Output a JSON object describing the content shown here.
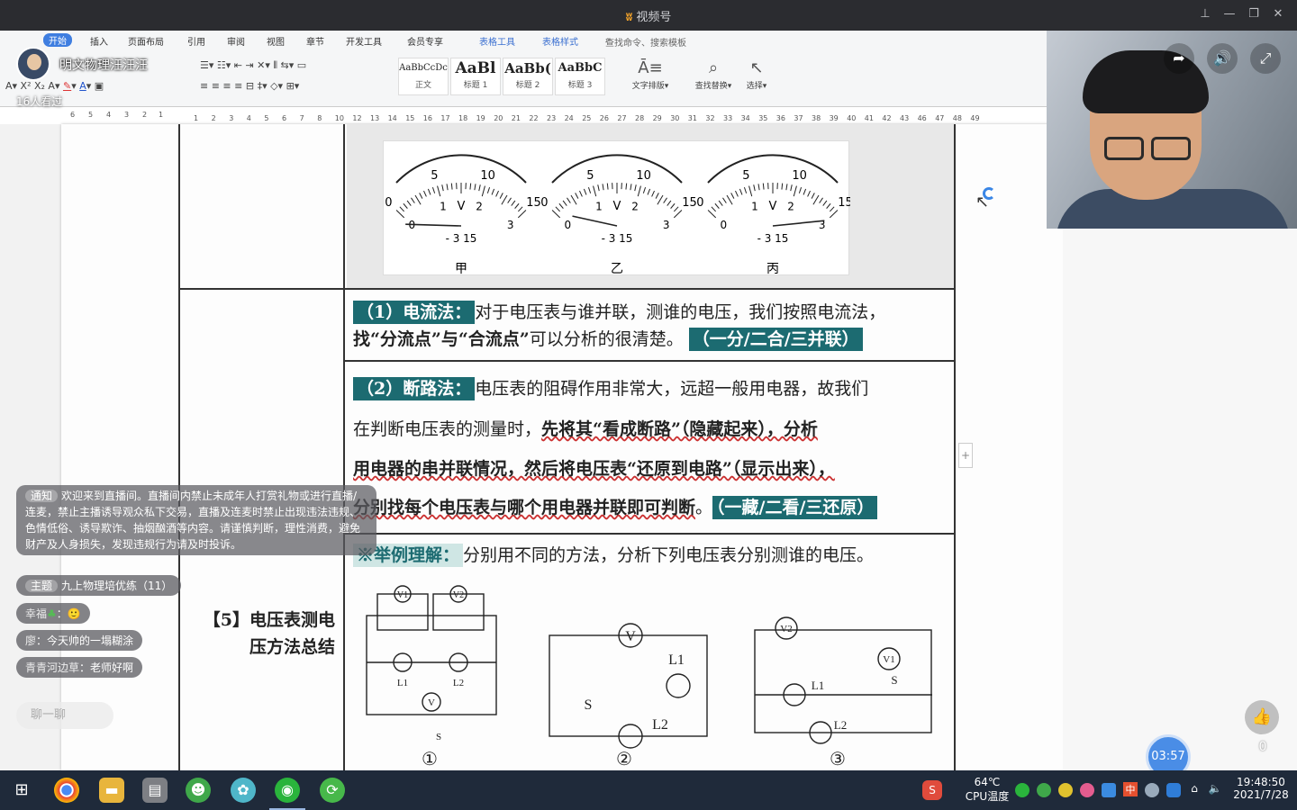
{
  "window": {
    "title": "视频号",
    "buttons": [
      "pin",
      "minimize",
      "restore",
      "close"
    ]
  },
  "host": {
    "name": "明文物理汪汪汪",
    "viewers": "16人看过"
  },
  "ribbon": {
    "menu": [
      "开始",
      "插入",
      "页面布局",
      "引用",
      "审阅",
      "视图",
      "章节",
      "开发工具",
      "会员专享",
      "表格工具",
      "表格样式"
    ],
    "search": "查找命令、搜索模板",
    "styles": [
      {
        "preview": "AaBbCcDc",
        "name": "正文"
      },
      {
        "preview": "AaBl",
        "name": "标题 1"
      },
      {
        "preview": "AaBb(",
        "name": "标题 2"
      },
      {
        "preview": "AaBbC",
        "name": "标题 3"
      }
    ],
    "tools": [
      {
        "icon": "text-layout-icon",
        "label": "文字排版"
      },
      {
        "icon": "find-replace-icon",
        "label": "查找替换"
      },
      {
        "icon": "select-icon",
        "label": "选择"
      }
    ]
  },
  "ruler": {
    "left": [
      "6",
      "5",
      "4",
      "3",
      "2",
      "1"
    ],
    "right": [
      "1",
      "2",
      "3",
      "4",
      "5",
      "6",
      "7",
      "8",
      "10",
      "12",
      "13",
      "14",
      "15",
      "16",
      "17",
      "18",
      "19",
      "20",
      "21",
      "22",
      "23",
      "24",
      "25",
      "26",
      "27",
      "28",
      "29",
      "30",
      "31",
      "32",
      "33",
      "34",
      "35",
      "36",
      "37",
      "38",
      "39",
      "40",
      "41",
      "42",
      "43",
      "46",
      "47",
      "48",
      "49"
    ]
  },
  "doc": {
    "meters": {
      "labels": [
        "甲",
        "乙",
        "丙"
      ],
      "scale_top": [
        "0",
        "5",
        "10",
        "15"
      ],
      "scale_bottom": [
        "0",
        "1",
        "2",
        "3"
      ],
      "unit": "V",
      "terminals": "- 3 15"
    },
    "method1": {
      "label": "（1）电流法：",
      "line1": "对于电压表与谁并联，测谁的电压，我们按照电流法，",
      "line2a": "找“分流点”与“合流点”",
      "line2b": "可以分析的很清楚。",
      "tag": "（一分/二合/三并联）"
    },
    "method2": {
      "label": "（2）断路法：",
      "line1": "电压表的阻碍作用非常大，远超一般用电器，故我们",
      "line2a": "在判断电压表的测量时，",
      "line2b": "先将其“看成断路”（隐藏起来），分析",
      "line3": "用电器的串并联情况，然后将电压表“还原到电路”（显示出来），",
      "line4a": "分别找每个电压表与哪个用电器并联即可判断",
      "line4b": "。",
      "tag": "（一藏/二看/三还原）"
    },
    "example": {
      "label": "※举例理解：",
      "text": "分别用不同的方法，分析下列电压表分别测谁的电压。"
    },
    "section_title_1": "【5】电压表测电",
    "section_title_2": "压方法总结",
    "circuits": {
      "numbers": [
        "①",
        "②",
        "③"
      ],
      "labels": [
        "V1",
        "V2",
        "V",
        "L1",
        "L2",
        "S"
      ]
    }
  },
  "chat": {
    "notice_tag": "通知",
    "notice": "欢迎来到直播间。直播间内禁止未成年人打赏礼物或进行直播/连麦，禁止主播诱导观众私下交易，直播及连麦时禁止出现违法违规、色情低俗、诱导欺诈、抽烟酗酒等内容。请谨慎判断，理性消费，避免财产及人身损失，发现违规行为请及时投诉。",
    "topic_tag": "主题",
    "topic": "九上物理培优练（11）",
    "messages": [
      {
        "user": "幸福",
        "text": "🙂"
      },
      {
        "user": "廖",
        "text": "今天帅的一塌糊涂"
      },
      {
        "user": "青青河边草",
        "text": "老师好啊"
      }
    ],
    "input_placeholder": "聊一聊"
  },
  "live": {
    "likes": "0",
    "timer": "03:57"
  },
  "taskbar": {
    "apps": [
      "start-icon",
      "chrome-icon",
      "folder-icon",
      "files-icon",
      "frog-icon",
      "gear-flower-icon",
      "wechat-icon",
      "green-app-icon"
    ],
    "temp": "64℃",
    "temp_label": "CPU温度",
    "ime": "中",
    "time": "19:48:50",
    "date": "2021/7/28"
  }
}
